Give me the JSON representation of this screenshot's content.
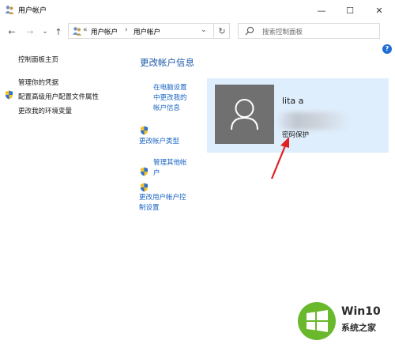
{
  "window": {
    "title": "用户帐户",
    "minimize": "—",
    "maximize": "☐",
    "close": "✕"
  },
  "nav": {
    "back": "←",
    "forward": "→",
    "recent": "⌄",
    "up": "↑",
    "overflow": "«",
    "breadcrumbs": [
      "用户帐户",
      "用户帐户"
    ],
    "breadcrumb_sep": "›",
    "dropdown": "⌄",
    "refresh": "↻",
    "search_placeholder": "搜索控制面板"
  },
  "sidebar": {
    "home": "控制面板主页",
    "items": [
      "管理你的凭据",
      "配置高级用户配置文件属性",
      "更改我的环境变量"
    ]
  },
  "main": {
    "heading": "更改帐户信息",
    "links": {
      "pc_settings": [
        "在电脑设置",
        "中更改我的",
        "帐户信息"
      ],
      "change_type": "更改帐户类型",
      "manage_other": [
        "管理其他帐",
        "户"
      ],
      "uac": [
        "更改用户帐户控",
        "制设置"
      ]
    }
  },
  "account": {
    "name": "lita a",
    "status": "密码保护"
  },
  "help_label": "?",
  "watermark": {
    "title": "Win10",
    "subtitle": "系统之家"
  },
  "colors": {
    "accent": "#1964c5",
    "heading": "#1e5aa8",
    "card_bg": "#dfeefc",
    "arrow": "#e02020",
    "avatar_bg": "#707070"
  }
}
